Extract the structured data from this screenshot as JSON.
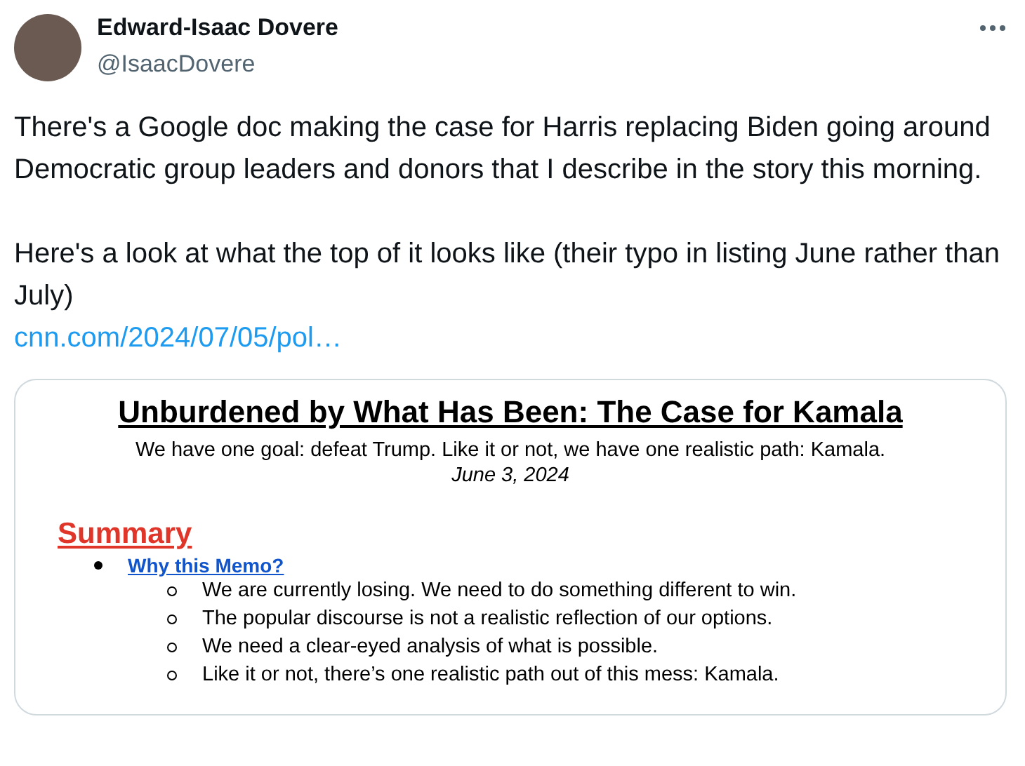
{
  "author": {
    "name": "Edward-Isaac Dovere",
    "handle": "@IsaacDovere"
  },
  "paragraphs": [
    "There's a Google doc making the case for Harris replacing Biden going around Democratic group leaders and donors that I describe in the story this morning.",
    "Here's a look at what the top of it looks like (their typo in listing June rather than July)"
  ],
  "link": "cnn.com/2024/07/05/pol…",
  "document": {
    "title": "Unburdened by What Has Been: The Case for Kamala",
    "subtitle": "We have one goal: defeat Trump. Like it or not, we have one realistic path: Kamala.",
    "date": "June 3, 2024",
    "heading": "Summary",
    "sections": [
      {
        "title": "Why this Memo?",
        "items": [
          "We are currently losing. We need to do something different to win.",
          "The popular discourse is not a realistic reflection of our options.",
          "We need a clear-eyed analysis of what is possible.",
          "Like it or not, there’s one realistic path out of this mess: Kamala."
        ]
      }
    ]
  }
}
